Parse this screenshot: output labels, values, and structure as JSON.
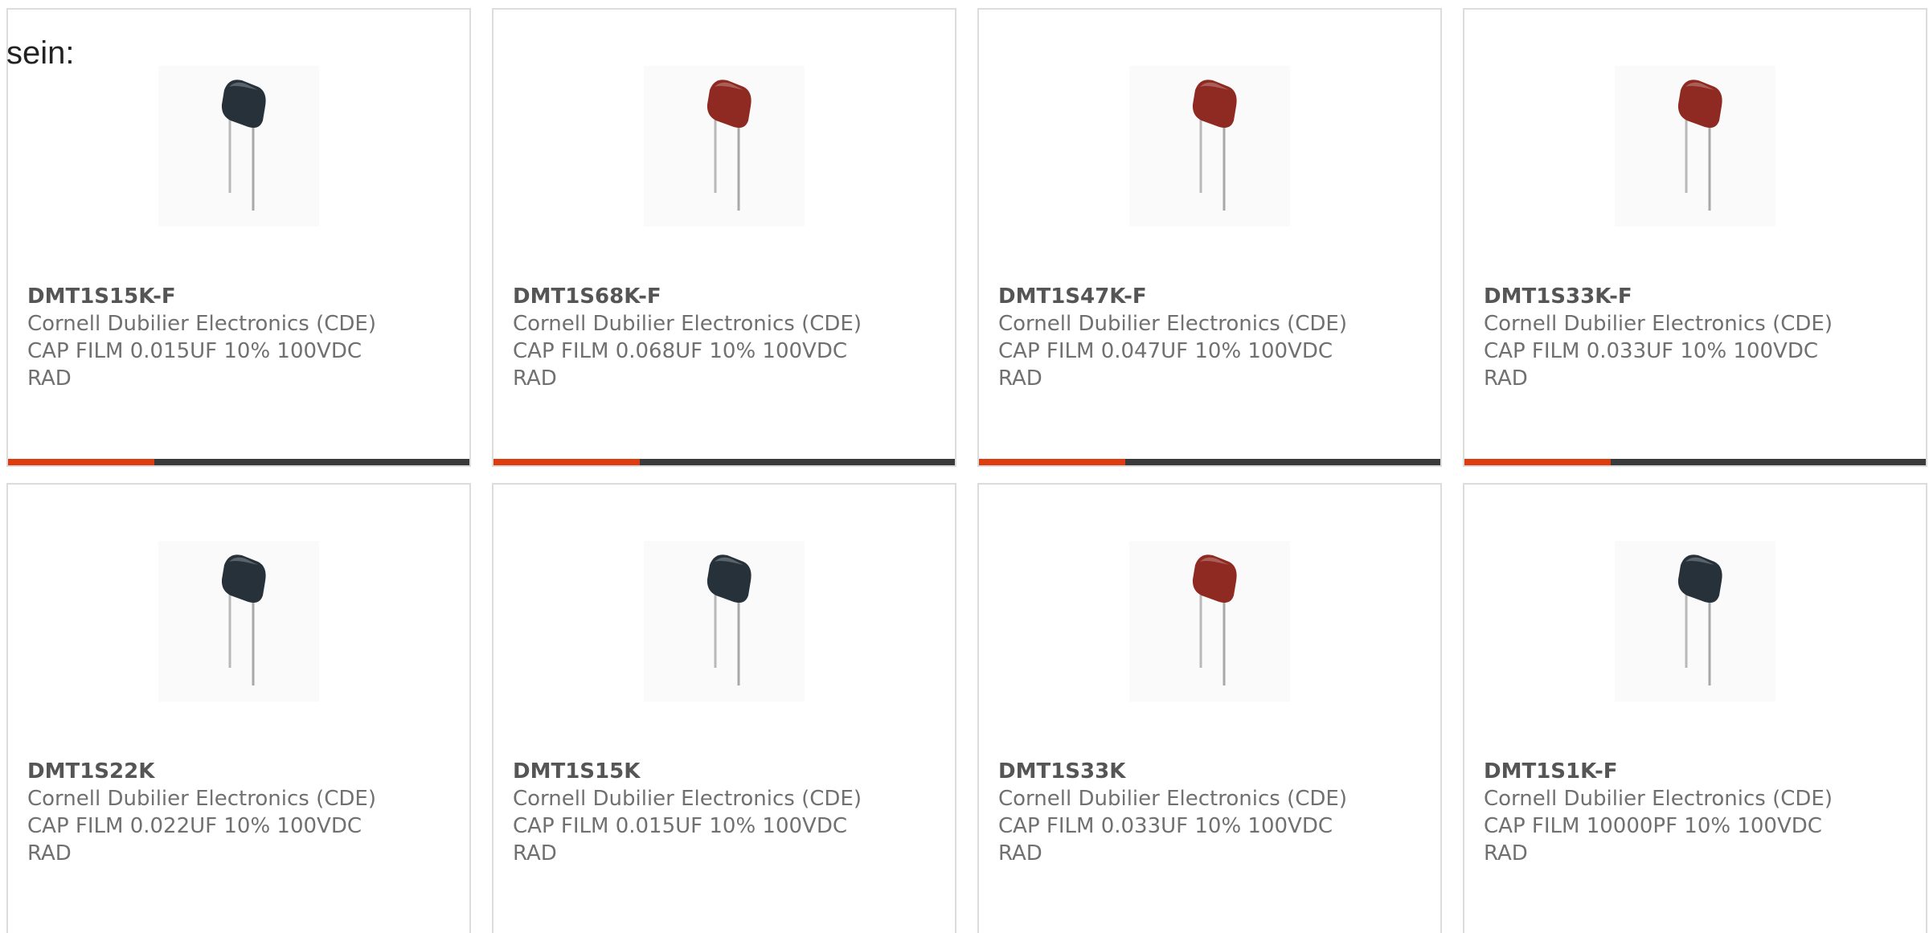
{
  "intro_text": "sein:",
  "products": [
    {
      "part": "DMT1S15K-F",
      "manufacturer": "Cornell Dubilier Electronics (CDE)",
      "description": "CAP FILM 0.015UF 10% 100VDC RAD",
      "body_color": "#26313a"
    },
    {
      "part": "DMT1S68K-F",
      "manufacturer": "Cornell Dubilier Electronics (CDE)",
      "description": "CAP FILM 0.068UF 10% 100VDC RAD",
      "body_color": "#8e2a22"
    },
    {
      "part": "DMT1S47K-F",
      "manufacturer": "Cornell Dubilier Electronics (CDE)",
      "description": "CAP FILM 0.047UF 10% 100VDC RAD",
      "body_color": "#8e2a22"
    },
    {
      "part": "DMT1S33K-F",
      "manufacturer": "Cornell Dubilier Electronics (CDE)",
      "description": "CAP FILM 0.033UF 10% 100VDC RAD",
      "body_color": "#8e2a22"
    },
    {
      "part": "DMT1S22K",
      "manufacturer": "Cornell Dubilier Electronics (CDE)",
      "description": "CAP FILM 0.022UF 10% 100VDC RAD",
      "body_color": "#26313a"
    },
    {
      "part": "DMT1S15K",
      "manufacturer": "Cornell Dubilier Electronics (CDE)",
      "description": "CAP FILM 0.015UF 10% 100VDC RAD",
      "body_color": "#26313a"
    },
    {
      "part": "DMT1S33K",
      "manufacturer": "Cornell Dubilier Electronics (CDE)",
      "description": "CAP FILM 0.033UF 10% 100VDC RAD",
      "body_color": "#8e2a22"
    },
    {
      "part": "DMT1S1K-F",
      "manufacturer": "Cornell Dubilier Electronics (CDE)",
      "description": "CAP FILM 10000PF 10% 100VDC RAD",
      "body_color": "#26313a"
    }
  ],
  "colors": {
    "accent": "#dd3c11",
    "accent_track": "#3a3a3a",
    "card_border": "#dcdcdc"
  }
}
